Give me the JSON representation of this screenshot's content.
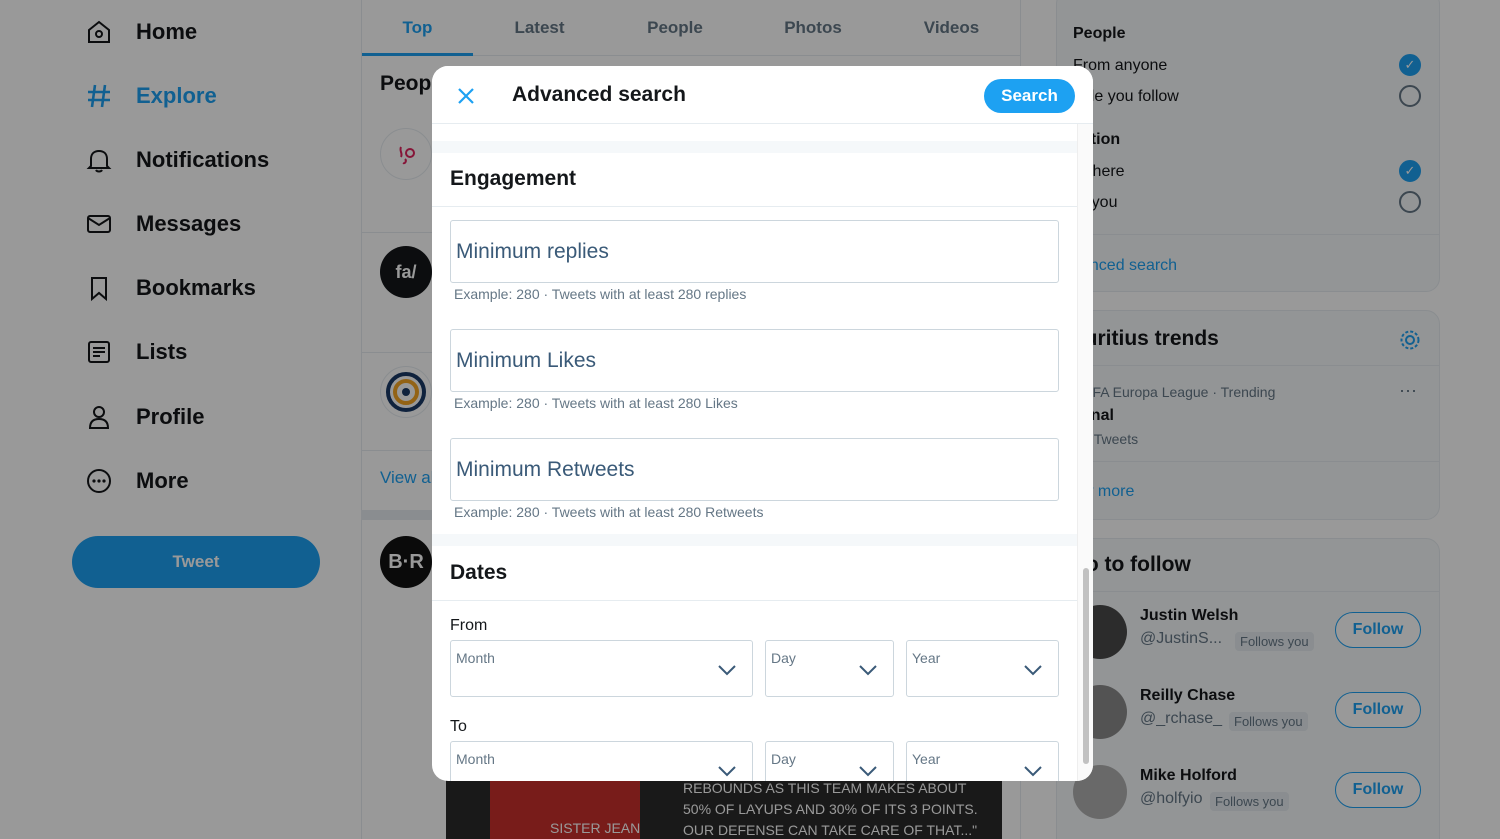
{
  "nav": {
    "items": [
      {
        "label": "Home",
        "icon": "home-icon"
      },
      {
        "label": "Explore",
        "icon": "hashtag-icon"
      },
      {
        "label": "Notifications",
        "icon": "bell-icon"
      },
      {
        "label": "Messages",
        "icon": "envelope-icon"
      },
      {
        "label": "Bookmarks",
        "icon": "bookmark-icon"
      },
      {
        "label": "Lists",
        "icon": "list-icon"
      },
      {
        "label": "Profile",
        "icon": "person-icon"
      },
      {
        "label": "More",
        "icon": "more-circle-icon"
      }
    ],
    "tweet_label": "Tweet"
  },
  "tabs": [
    "Top",
    "Latest",
    "People",
    "Photos",
    "Videos"
  ],
  "center": {
    "people_title": "Peop",
    "avatar2_text": "fa/",
    "view_all": "View al",
    "avatar4_text": "B·R",
    "media_text": [
      "REBOUNDS AS THIS TEAM MAKES ABOUT",
      "50% OF LAYUPS AND 30% OF ITS 3 POINTS.",
      "OUR DEFENSE CAN TAKE CARE OF THAT...\""
    ],
    "media_name": "SISTER JEAN"
  },
  "filters": {
    "people_title": "People",
    "people_opt1": "From anyone",
    "people_opt2": "ople you follow",
    "location_title": "cation",
    "location_opt1": "ywhere",
    "location_opt2": "ar you",
    "advanced_link": "vanced search"
  },
  "trends": {
    "title": "auritius trends",
    "meta": "UEFA Europa League · Trending",
    "name": "senal",
    "count": "0K Tweets",
    "show_more": "ow more"
  },
  "who_to_follow": {
    "title": "ho to follow",
    "follow_label": "Follow",
    "users": [
      {
        "name": "Justin Welsh",
        "handle": "@JustinS...",
        "badge": "Follows you"
      },
      {
        "name": "Reilly Chase",
        "handle": "@_rchase_",
        "badge": "Follows you"
      },
      {
        "name": "Mike Holford",
        "handle": "@holfyio",
        "badge": "Follows you"
      }
    ]
  },
  "modal": {
    "title": "Advanced search",
    "search_label": "Search",
    "engagement_title": "Engagement",
    "fields": [
      {
        "placeholder": "Minimum replies",
        "hint": "Example: 280 · Tweets with at least 280 replies"
      },
      {
        "placeholder": "Minimum Likes",
        "hint": "Example: 280 · Tweets with at least 280 Likes"
      },
      {
        "placeholder": "Minimum Retweets",
        "hint": "Example: 280 · Tweets with at least 280 Retweets"
      }
    ],
    "dates_title": "Dates",
    "from_label": "From",
    "to_label": "To",
    "month": "Month",
    "day": "Day",
    "year": "Year"
  },
  "colors": {
    "accent": "#1da1f2",
    "text": "#14171a",
    "muted": "#657786"
  }
}
